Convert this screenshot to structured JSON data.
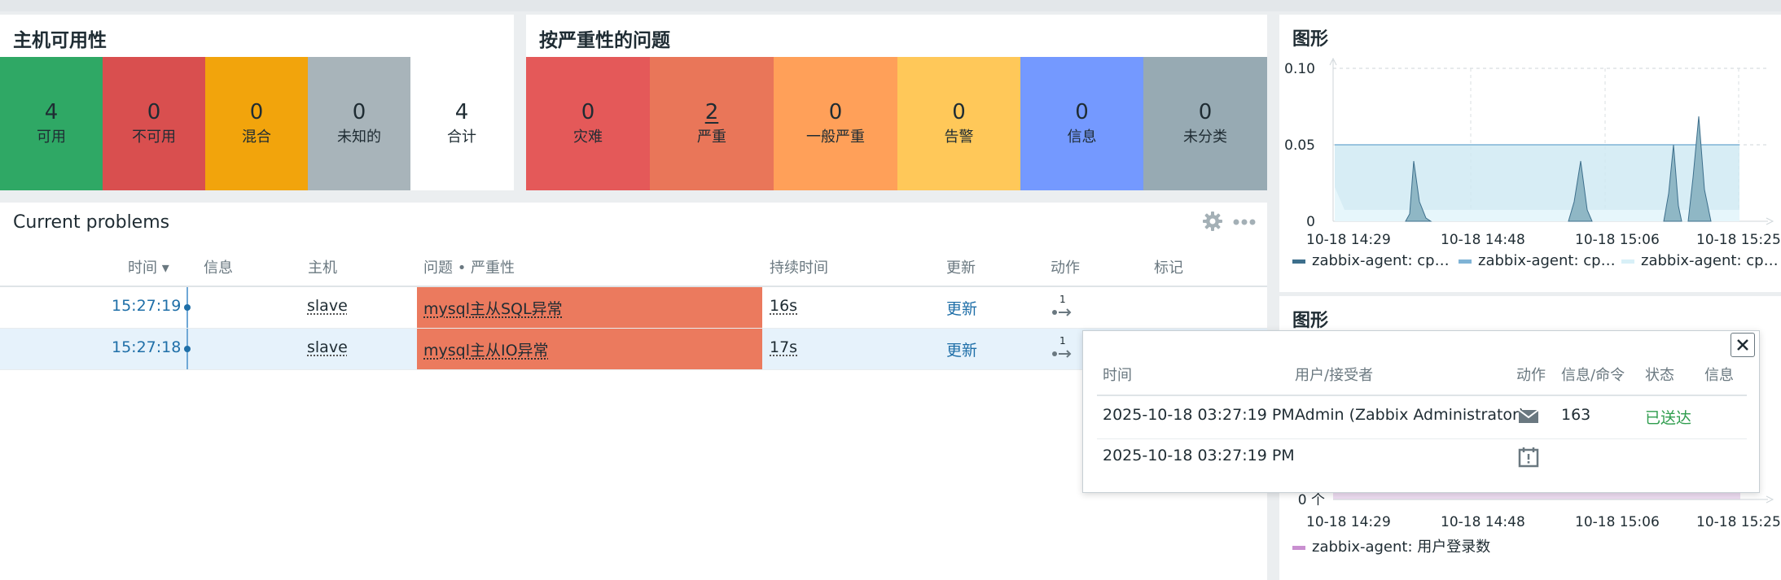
{
  "colors": {
    "available": "#2fa865",
    "unavailable": "#d94f4f",
    "mixed": "#f2a40c",
    "unknown": "#a8b4ba",
    "disaster": "#e45959",
    "high": "#e97659",
    "average": "#ffa059",
    "warning": "#ffc859",
    "information": "#7499ff",
    "not_classified": "#97aab3",
    "link": "#1f6fa8",
    "delivered": "#2f9d4e"
  },
  "host_availability": {
    "title": "主机可用性",
    "tiles": [
      {
        "value": "4",
        "label": "可用"
      },
      {
        "value": "0",
        "label": "不可用"
      },
      {
        "value": "0",
        "label": "混合"
      },
      {
        "value": "0",
        "label": "未知的"
      },
      {
        "value": "4",
        "label": "合计"
      }
    ]
  },
  "problems_by_severity": {
    "title": "按严重性的问题",
    "tiles": [
      {
        "value": "0",
        "label": "灾难"
      },
      {
        "value": "2",
        "label": "严重"
      },
      {
        "value": "0",
        "label": "一般严重"
      },
      {
        "value": "0",
        "label": "告警"
      },
      {
        "value": "0",
        "label": "信息"
      },
      {
        "value": "0",
        "label": "未分类"
      }
    ]
  },
  "current_problems": {
    "title": "Current problems",
    "icons": {
      "settings": "gear-icon",
      "menu": "kebab-menu-icon"
    },
    "columns": [
      "时间",
      "信息",
      "主机",
      "问题 • 严重性",
      "持续时间",
      "更新",
      "动作",
      "标记"
    ],
    "sort_indicator": "▾",
    "rows": [
      {
        "time": "15:27:19",
        "host": "slave",
        "problem": "mysql主从SQL异常",
        "duration": "16s",
        "update": "更新",
        "action_count": "1"
      },
      {
        "time": "15:27:18",
        "host": "slave",
        "problem": "mysql主从IO异常",
        "duration": "17s",
        "update": "更新",
        "action_count": "1"
      }
    ]
  },
  "graph1": {
    "title": "图形",
    "chart_data": {
      "type": "area",
      "y_ticks": [
        "0.10",
        "0.05",
        "0"
      ],
      "x_ticks": [
        "10-18 14:29",
        "10-18 14:48",
        "10-18 15:06",
        "10-18 15:25"
      ],
      "ylim": [
        0,
        0.1
      ],
      "series": [
        {
          "name": "zabbix-agent: cp…",
          "color": "#3d6f8c"
        },
        {
          "name": "zabbix-agent: cp…",
          "color": "#7fb3d5"
        },
        {
          "name": "zabbix-agent: cp…",
          "color": "#d8f0f7"
        }
      ]
    }
  },
  "graph2": {
    "title": "图形",
    "chart_data": {
      "type": "area",
      "y_ticks": [
        "0 个"
      ],
      "x_ticks": [
        "10-18 14:29",
        "10-18 14:48",
        "10-18 15:06",
        "10-18 15:25"
      ],
      "series": [
        {
          "name": "zabbix-agent: 用户登录数",
          "color": "#c98fd0"
        }
      ]
    }
  },
  "popup": {
    "columns": [
      "时间",
      "用户/接受者",
      "动作",
      "信息/命令",
      "状态",
      "信息"
    ],
    "rows": [
      {
        "time": "2025-10-18 03:27:19 PM",
        "recipient": "Admin (Zabbix Administrator)",
        "action_icon": "envelope-icon",
        "message": "163",
        "status": "已送达",
        "info": ""
      },
      {
        "time": "2025-10-18 03:27:19 PM",
        "recipient": "",
        "action_icon": "calendar-alert-icon",
        "message": "",
        "status": "",
        "info": ""
      }
    ],
    "close_icon": "close-icon"
  }
}
